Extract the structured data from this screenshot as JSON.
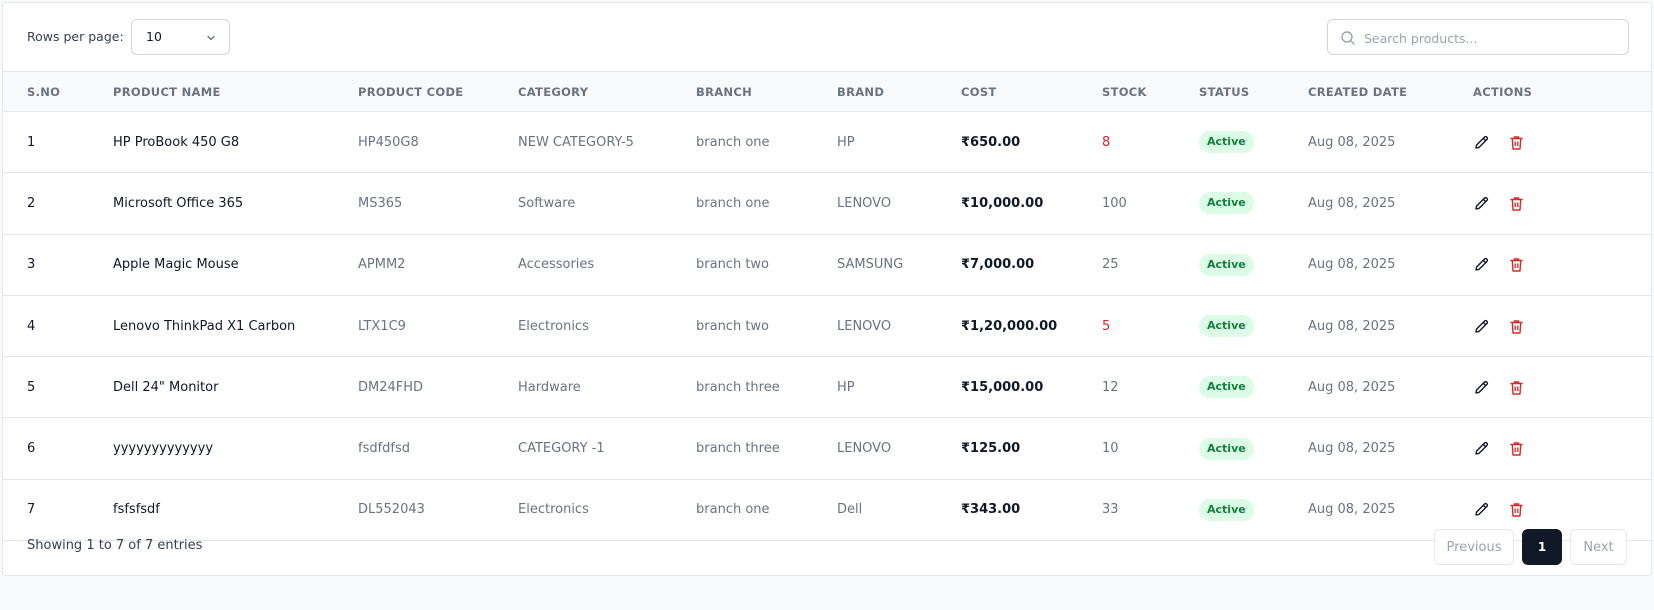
{
  "toolbar": {
    "rows_per_page_label": "Rows per page:",
    "rows_per_page_value": "10",
    "search_placeholder": "Search products..."
  },
  "table": {
    "columns": [
      "S.NO",
      "PRODUCT NAME",
      "PRODUCT CODE",
      "CATEGORY",
      "BRANCH",
      "BRAND",
      "COST",
      "STOCK",
      "STATUS",
      "CREATED DATE",
      "ACTIONS"
    ],
    "rows": [
      {
        "sno": "1",
        "name": "HP ProBook 450 G8",
        "code": "HP450G8",
        "category": "NEW CATEGORY-5",
        "branch": "branch one",
        "brand": "HP",
        "cost": "₹650.00",
        "stock": "8",
        "low_stock": true,
        "status": "Active",
        "created": "Aug 08, 2025"
      },
      {
        "sno": "2",
        "name": "Microsoft Office 365",
        "code": "MS365",
        "category": "Software",
        "branch": "branch one",
        "brand": "LENOVO",
        "cost": "₹10,000.00",
        "stock": "100",
        "low_stock": false,
        "status": "Active",
        "created": "Aug 08, 2025"
      },
      {
        "sno": "3",
        "name": "Apple Magic Mouse",
        "code": "APMM2",
        "category": "Accessories",
        "branch": "branch two",
        "brand": "SAMSUNG",
        "cost": "₹7,000.00",
        "stock": "25",
        "low_stock": false,
        "status": "Active",
        "created": "Aug 08, 2025"
      },
      {
        "sno": "4",
        "name": "Lenovo ThinkPad X1 Carbon",
        "code": "LTX1C9",
        "category": "Electronics",
        "branch": "branch two",
        "brand": "LENOVO",
        "cost": "₹1,20,000.00",
        "stock": "5",
        "low_stock": true,
        "status": "Active",
        "created": "Aug 08, 2025"
      },
      {
        "sno": "5",
        "name": "Dell 24\" Monitor",
        "code": "DM24FHD",
        "category": "Hardware",
        "branch": "branch three",
        "brand": "HP",
        "cost": "₹15,000.00",
        "stock": "12",
        "low_stock": false,
        "status": "Active",
        "created": "Aug 08, 2025"
      },
      {
        "sno": "6",
        "name": "yyyyyyyyyyyyy",
        "code": "fsdfdfsd",
        "category": "CATEGORY -1",
        "branch": "branch three",
        "brand": "LENOVO",
        "cost": "₹125.00",
        "stock": "10",
        "low_stock": false,
        "status": "Active",
        "created": "Aug 08, 2025"
      },
      {
        "sno": "7",
        "name": "fsfsfsdf",
        "code": "DL552043",
        "category": "Electronics",
        "branch": "branch one",
        "brand": "Dell",
        "cost": "₹343.00",
        "stock": "33",
        "low_stock": false,
        "status": "Active",
        "created": "Aug 08, 2025"
      }
    ]
  },
  "footer": {
    "showing_text": "Showing 1 to 7 of 7 entries",
    "previous_label": "Previous",
    "current_page": "1",
    "next_label": "Next"
  },
  "colors": {
    "low_stock": "#dc2626",
    "badge_bg": "#dcfce7",
    "badge_text": "#15803d",
    "delete": "#dc2626",
    "active_page": "#111827"
  },
  "icons": {
    "select": "chevron-down-icon",
    "search": "search-icon",
    "edit": "pencil-icon",
    "delete": "trash-icon"
  }
}
